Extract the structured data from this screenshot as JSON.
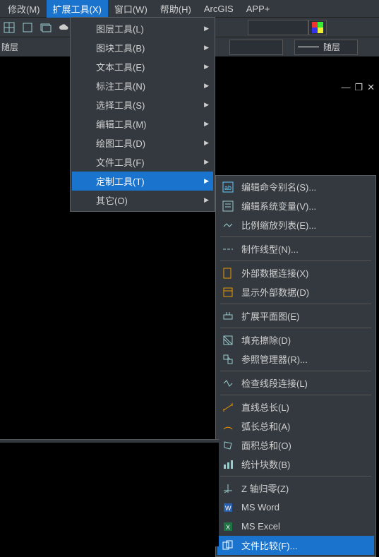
{
  "menubar": {
    "modify": "修改(M)",
    "ext": "扩展工具(X)",
    "window": "窗口(W)",
    "help": "帮助(H)",
    "arcgis": "ArcGIS",
    "app": "APP+"
  },
  "layerLabel": "随层",
  "lineStyleLabel": "随层",
  "menu1": {
    "layer": "图层工具(L)",
    "block": "图块工具(B)",
    "text": "文本工具(E)",
    "dim": "标注工具(N)",
    "select": "选择工具(S)",
    "edit": "编辑工具(M)",
    "draw": "绘图工具(D)",
    "file": "文件工具(F)",
    "custom": "定制工具(T)",
    "other": "其它(O)"
  },
  "menu2": {
    "alias": "编辑命令别名(S)...",
    "sysvar": "编辑系统变量(V)...",
    "scalelist": "比例缩放列表(E)...",
    "linetype": "制作线型(N)...",
    "extdb": "外部数据连接(X)",
    "showext": "显示外部数据(D)",
    "flatten": "扩展平面图(E)",
    "hatchdel": "填充擦除(D)",
    "refman": "参照管理器(R)...",
    "checkseg": "检查线段连接(L)",
    "linelen": "直线总长(L)",
    "arclen": "弧长总和(A)",
    "area": "面积总和(O)",
    "stats": "统计块数(B)",
    "zzero": "Z 轴归零(Z)",
    "msword": "MS Word",
    "msexcel": "MS Excel",
    "filecmp": "文件比较(F)..."
  },
  "winbtns": {
    "min": "—",
    "restore": "❐",
    "close": "✕"
  }
}
